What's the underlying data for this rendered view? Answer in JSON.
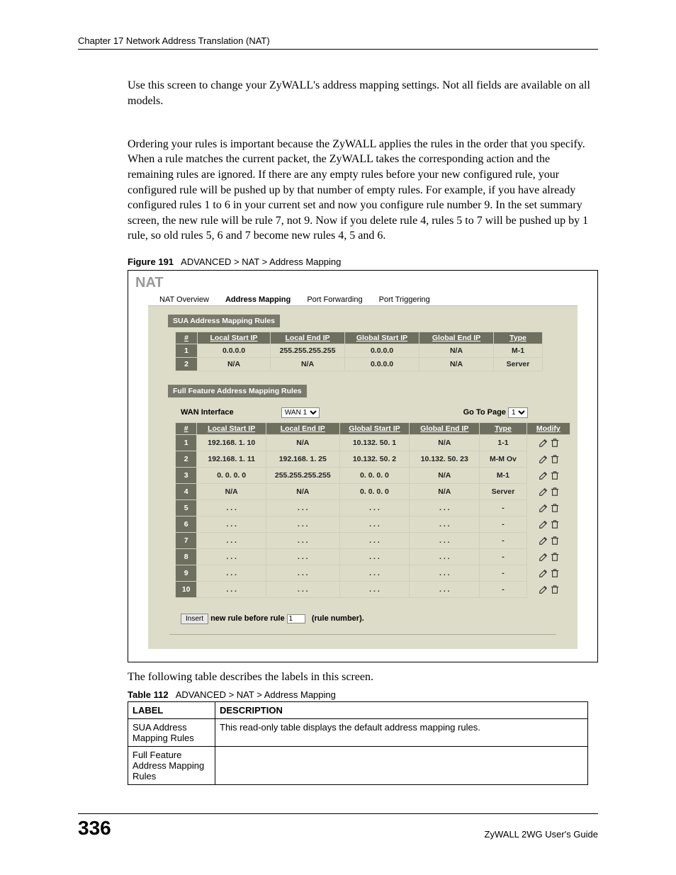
{
  "header": {
    "chapter": "Chapter 17 Network Address Translation (NAT)"
  },
  "body": {
    "para1": "Use this screen to change your ZyWALL's address mapping settings. Not all fields are available on all models.",
    "para2": "Ordering your rules is important because the ZyWALL applies the rules in the order that you specify. When a rule matches the current packet, the ZyWALL takes the corresponding action and the remaining rules are ignored. If there are any empty rules before your new configured rule, your configured rule will be pushed up by that number of empty rules. For example, if you have already configured rules 1 to 6 in your current set and now you configure rule number 9. In the set summary screen, the new rule will be rule 7, not 9. Now if you delete rule 4, rules 5 to 7 will be pushed up by 1 rule, so old rules 5, 6 and 7 become new rules 4, 5 and 6.",
    "after_fig": "The following table describes the labels in this screen."
  },
  "figure": {
    "label": "Figure 191",
    "title": "ADVANCED > NAT > Address Mapping"
  },
  "screenshot": {
    "nat_title": "NAT",
    "tabs": [
      "NAT Overview",
      "Address Mapping",
      "Port Forwarding",
      "Port Triggering"
    ],
    "sua_title": "SUA Address Mapping Rules",
    "headers": {
      "num": "#",
      "lstart": "Local Start IP",
      "lend": "Local End IP",
      "gstart": "Global Start IP",
      "gend": "Global End IP",
      "type": "Type",
      "modify": "Modify"
    },
    "sua_rows": [
      {
        "n": "1",
        "ls": "0.0.0.0",
        "le": "255.255.255.255",
        "gs": "0.0.0.0",
        "ge": "N/A",
        "t": "M-1"
      },
      {
        "n": "2",
        "ls": "N/A",
        "le": "N/A",
        "gs": "0.0.0.0",
        "ge": "N/A",
        "t": "Server"
      }
    ],
    "full_title": "Full Feature Address Mapping Rules",
    "wan_label": "WAN Interface",
    "wan_value": "WAN 1",
    "goto_label": "Go To Page",
    "goto_value": "1",
    "full_rows": [
      {
        "n": "1",
        "ls": "192.168. 1. 10",
        "le": "N/A",
        "gs": "10.132. 50. 1",
        "ge": "N/A",
        "t": "1-1"
      },
      {
        "n": "2",
        "ls": "192.168. 1. 11",
        "le": "192.168. 1. 25",
        "gs": "10.132. 50. 2",
        "ge": "10.132. 50. 23",
        "t": "M-M Ov"
      },
      {
        "n": "3",
        "ls": "0. 0. 0. 0",
        "le": "255.255.255.255",
        "gs": "0. 0. 0. 0",
        "ge": "N/A",
        "t": "M-1"
      },
      {
        "n": "4",
        "ls": "N/A",
        "le": "N/A",
        "gs": "0. 0. 0. 0",
        "ge": "N/A",
        "t": "Server"
      },
      {
        "n": "5",
        "ls": ". . .",
        "le": ". . .",
        "gs": ". . .",
        "ge": ". . .",
        "t": "-"
      },
      {
        "n": "6",
        "ls": ". . .",
        "le": ". . .",
        "gs": ". . .",
        "ge": ". . .",
        "t": "-"
      },
      {
        "n": "7",
        "ls": ". . .",
        "le": ". . .",
        "gs": ". . .",
        "ge": ". . .",
        "t": "-"
      },
      {
        "n": "8",
        "ls": ". . .",
        "le": ". . .",
        "gs": ". . .",
        "ge": ". . .",
        "t": "-"
      },
      {
        "n": "9",
        "ls": ". . .",
        "le": ". . .",
        "gs": ". . .",
        "ge": ". . .",
        "t": "-"
      },
      {
        "n": "10",
        "ls": ". . .",
        "le": ". . .",
        "gs": ". . .",
        "ge": ". . .",
        "t": "-"
      }
    ],
    "insert_btn": "Insert",
    "insert_before": "new rule before rule",
    "insert_value": "1",
    "insert_after": "(rule number)."
  },
  "table": {
    "label": "Table 112",
    "title": "ADVANCED > NAT > Address Mapping",
    "head_label": "LABEL",
    "head_desc": "DESCRIPTION",
    "rows": [
      {
        "label": "SUA Address Mapping Rules",
        "desc": "This read-only table displays the default address mapping rules."
      },
      {
        "label": "Full Feature Address Mapping Rules",
        "desc": ""
      }
    ]
  },
  "footer": {
    "page": "336",
    "guide": "ZyWALL 2WG User's Guide"
  }
}
